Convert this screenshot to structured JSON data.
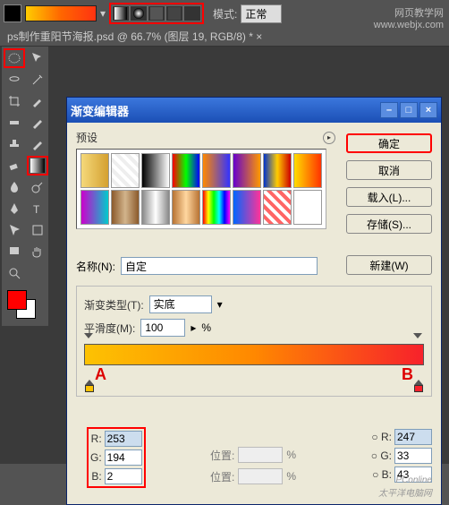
{
  "watermark_top": "网页教学网\nwww.webjx.com",
  "options": {
    "mode_label": "模式:",
    "mode_value": "正常"
  },
  "doc_tab": "ps制作重阳节海报.psd @ 66.7% (图层 19, RGB/8) * ×",
  "dialog": {
    "title": "渐变编辑器",
    "presets_label": "预设",
    "buttons": {
      "ok": "确定",
      "cancel": "取消",
      "load": "载入(L)...",
      "save": "存储(S)..."
    },
    "name_label": "名称(N):",
    "name_value": "自定",
    "new_btn": "新建(W)",
    "type_label": "渐变类型(T):",
    "type_value": "实底",
    "smooth_label": "平滑度(M):",
    "smooth_value": "100",
    "pct": "%",
    "pos_label": "位置:",
    "pct2": "%",
    "annotA": "A",
    "annotB": "B",
    "rgbA": {
      "r": "253",
      "g": "194",
      "b": "2"
    },
    "rgbB": {
      "r": "247",
      "g": "33",
      "b": "43"
    },
    "labels": {
      "r": "R:",
      "g": "G:",
      "b": "B:"
    }
  },
  "presets": [
    "linear-gradient(90deg,#f5d97a,#d4a030)",
    "repeating-linear-gradient(45deg,#fff 0 4px,#eee 4px 8px)",
    "linear-gradient(90deg,#000,#fff)",
    "linear-gradient(90deg,#f00,#0f0,#00f)",
    "linear-gradient(90deg,#ff8800,#3333ff)",
    "linear-gradient(90deg,#6600cc,#ff9900)",
    "linear-gradient(90deg,#0033cc,#ffcc00,#cc0000)",
    "linear-gradient(90deg,#ffdd00,#ff3300)",
    "linear-gradient(90deg,#cc00cc,#00cccc)",
    "linear-gradient(90deg,#8b5a2b,#d2b48c,#8b5a2b)",
    "linear-gradient(90deg,#888,#fff,#888)",
    "linear-gradient(90deg,#b87333,#ffd7a0,#b87333)",
    "linear-gradient(90deg,#f00,#ff0,#0f0,#0ff,#00f,#f0f)",
    "linear-gradient(90deg,#0066ff,#ff3399)",
    "repeating-linear-gradient(45deg,#fff 0 4px,#f66 4px 8px)",
    "#fff"
  ],
  "wm_bottom": "PConline\n太平洋电脑网"
}
